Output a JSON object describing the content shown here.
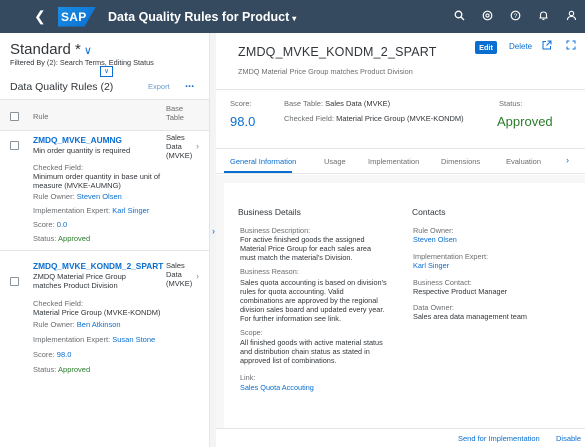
{
  "shell": {
    "back_icon": "back-icon",
    "logo": "SAP",
    "app_title": "Data Quality Rules for Product",
    "app_title_caret": "▾",
    "icons": [
      "search-icon",
      "copilot-icon",
      "help-icon",
      "notifications-icon",
      "user-icon"
    ]
  },
  "left": {
    "variant": "Standard *",
    "variant_chevron": "∨",
    "filter_info": "Filtered By (2): Search Terms, Editing Status",
    "collapse_icon": "∨",
    "list_title": "Data Quality Rules (2)",
    "export_label": "Export",
    "more_label": "...",
    "columns": {
      "rule": "Rule",
      "base_table": "Base Table"
    },
    "rows": [
      {
        "name": "ZMDQ_MVKE_AUMNG",
        "description": "Min order quantity is required",
        "base_table": "Sales Data (MVKE)",
        "checked_field_label": "Checked Field:",
        "checked_field_value": "Minimum order quantity in base unit of measure (MVKE-AUMNG)",
        "rule_owner_label": "Rule Owner:",
        "rule_owner": "Steven Olsen",
        "impl_expert_label": "Implementation Expert:",
        "impl_expert": "Karl Singer",
        "score_label": "Score:",
        "score": "0.0",
        "status_label": "Status:",
        "status": "Approved"
      },
      {
        "name": "ZMDQ_MVKE_KONDM_2_SPART",
        "description": "ZMDQ Material Price Group matches Product Division",
        "base_table": "Sales Data (MVKE)",
        "checked_field_label": "Checked Field:",
        "checked_field_value": "Material Price Group (MVKE-KONDM)",
        "rule_owner_label": "Rule Owner:",
        "rule_owner": "Ben Atkinson",
        "impl_expert_label": "Implementation Expert:",
        "impl_expert": "Susan Stone",
        "score_label": "Score:",
        "score": "98.0",
        "status_label": "Status:",
        "status": "Approved"
      }
    ]
  },
  "detail": {
    "title": "ZMDQ_MVKE_KONDM_2_SPART",
    "subtitle": "ZMDQ Material Price Group matches Product Division",
    "edit_label": "Edit",
    "delete_label": "Delete",
    "share_icon": "share-icon",
    "fullscreen_icon": "fullscreen-icon",
    "score_label": "Score:",
    "score": "98.0",
    "base_table_label": "Base Table:",
    "base_table": "Sales Data (MVKE)",
    "checked_field_label": "Checked Field:",
    "checked_field": "Material Price Group (MVKE-KONDM)",
    "status_label": "Status:",
    "status": "Approved",
    "tabs": [
      "General Information",
      "Usage",
      "Implementation",
      "Dimensions",
      "Evaluation"
    ],
    "selected_tab": "General Information",
    "business_details": {
      "title": "Business Details",
      "description_label": "Business Description:",
      "description": [
        "For active finished goods the assigned",
        "Material Price Group for each sales area",
        "must match the material's Division."
      ],
      "reason_label": "Business Reason:",
      "reason": [
        "Sales quota accounting is based on division's",
        "rules for quota accounting. Valid",
        "combinations are approved by the regional",
        "division sales board and updated every year.",
        "For further information see link."
      ],
      "scope_label": "Scope:",
      "scope": [
        "All finished goods with active material status",
        "and distribution chain status as stated in",
        "approved list of combinations."
      ],
      "link_label": "Link:",
      "link": "Sales Quota Accouting"
    },
    "contacts": {
      "title": "Contacts",
      "rule_owner_label": "Rule Owner:",
      "rule_owner": "Steven Olsen",
      "impl_expert_label": "Implementation Expert:",
      "impl_expert": "Karl Singer",
      "business_contact_label": "Business Contact:",
      "business_contact": "Respective Product Manager",
      "data_owner_label": "Data Owner:",
      "data_owner": "Sales area data management team"
    }
  },
  "footer": {
    "send_label": "Send for Implementation",
    "disable_label": "Disable"
  }
}
